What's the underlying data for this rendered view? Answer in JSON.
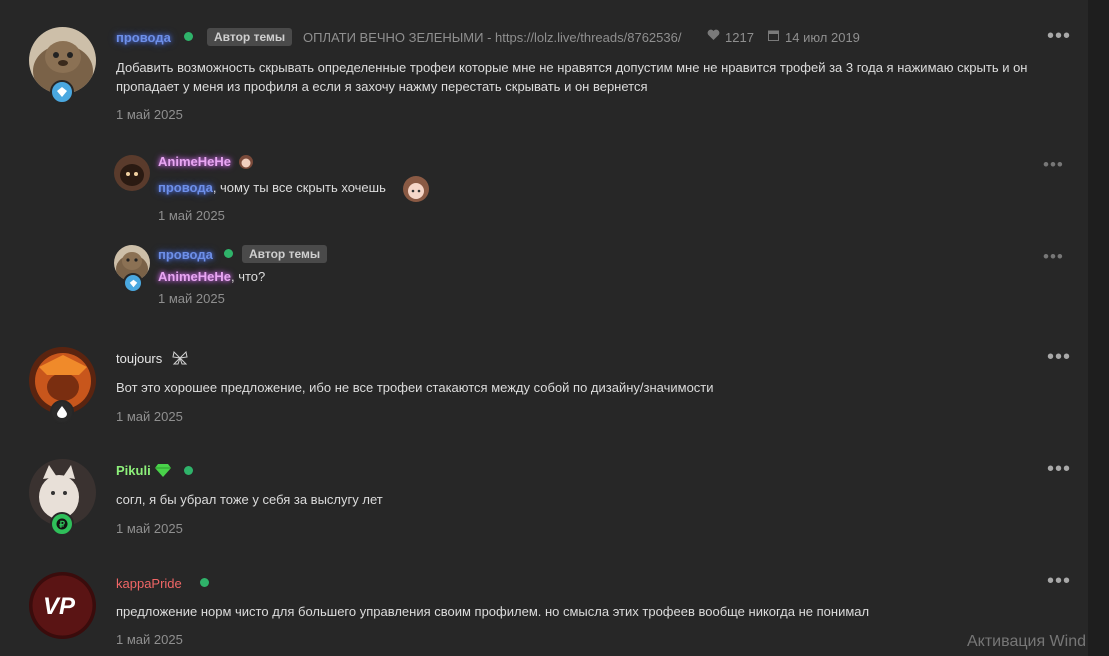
{
  "thread": {
    "author": "провода",
    "author_badge": "Автор темы",
    "link_text": "ОПЛАТИ ВЕЧНО ЗЕЛЕНЫМИ - https://lolz.live/threads/8762536/",
    "likes": "1217",
    "date": "14 июл 2019",
    "body": "Добавить возможность скрывать определенные трофеи которые мне не нравятся допустим мне не нравится трофей за 3 года я нажимаю скрыть и он пропадает у меня из профиля а если я захочу нажму перестать скрывать и он вернется",
    "post_date": "1 май 2025",
    "menu": "•••"
  },
  "replies": [
    {
      "username": "AnimeHeHe",
      "mention": "провода",
      "text": ", чому ты все скрыть хочешь",
      "date": "1 май 2025",
      "menu": "•••"
    },
    {
      "username": "провода",
      "author_badge": "Автор темы",
      "mention": "AnimeHeHe",
      "text": ", что?",
      "date": "1 май 2025",
      "menu": "•••"
    }
  ],
  "comments": [
    {
      "username": "toujours",
      "text": "Вот это хорошее предложение, ибо не все трофеи стакаются между собой по дизайну/значимости",
      "date": "1 май 2025",
      "menu": "•••"
    },
    {
      "username": "Pikuli",
      "text": "согл, я бы убрал тоже у себя за выслугу лет",
      "date": "1 май 2025",
      "menu": "•••"
    },
    {
      "username": "kappaPride",
      "avatar_text": "VP",
      "text": "предложение норм чисто для большего управления своим профилем. но смысла этих трофеев вообще никогда не понимал",
      "date": "1 май 2025",
      "menu": "•••"
    }
  ],
  "watermark": "Активация Wind",
  "colors": {
    "background": "#272727",
    "online": "#2fb36a",
    "provoda_name": "#6d8fe8",
    "anime_name": "#e8a6f2",
    "pikuli_name": "#8df07a",
    "kappa_name": "#f06666"
  }
}
